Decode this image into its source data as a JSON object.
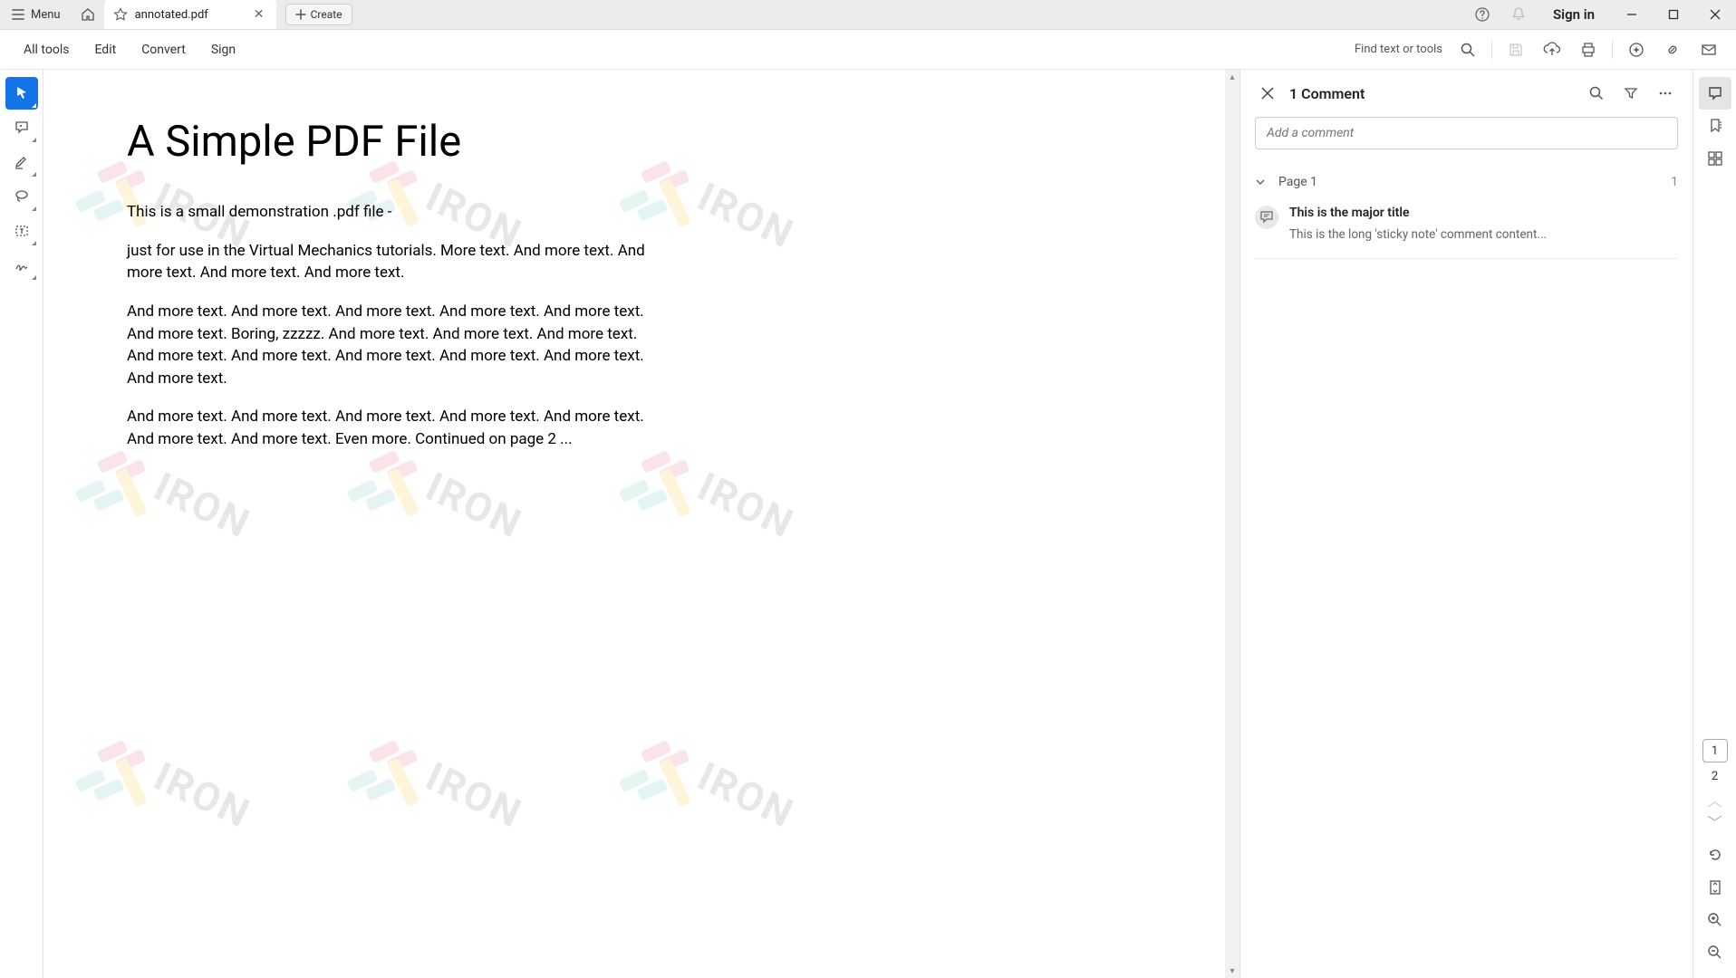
{
  "titlebar": {
    "menu_label": "Menu",
    "tab_title": "annotated.pdf",
    "create_label": "Create",
    "signin_label": "Sign in"
  },
  "toolbar": {
    "items": [
      "All tools",
      "Edit",
      "Convert",
      "Sign"
    ],
    "find_label": "Find text or tools"
  },
  "document": {
    "title": "A Simple PDF File",
    "paragraphs": [
      "This is a small demonstration .pdf file -",
      "just for use in the Virtual Mechanics tutorials. More text. And more text. And more text. And more text. And more text.",
      "And more text. And more text. And more text. And more text. And more text. And more text. Boring, zzzzz. And more text. And more text. And more text. And more text. And more text. And more text. And more text. And more text. And more text.",
      "And more text. And more text. And more text. And more text. And more text. And more text. And more text. Even more. Continued on page 2 ..."
    ],
    "watermark_text": "IRON"
  },
  "comments": {
    "panel_title": "1 Comment",
    "add_placeholder": "Add a comment",
    "group_label": "Page 1",
    "group_count": "1",
    "items": [
      {
        "title": "This is the major title",
        "text": "This is the long 'sticky note' comment content..."
      }
    ]
  },
  "pages": {
    "current": "1",
    "other": "2"
  }
}
